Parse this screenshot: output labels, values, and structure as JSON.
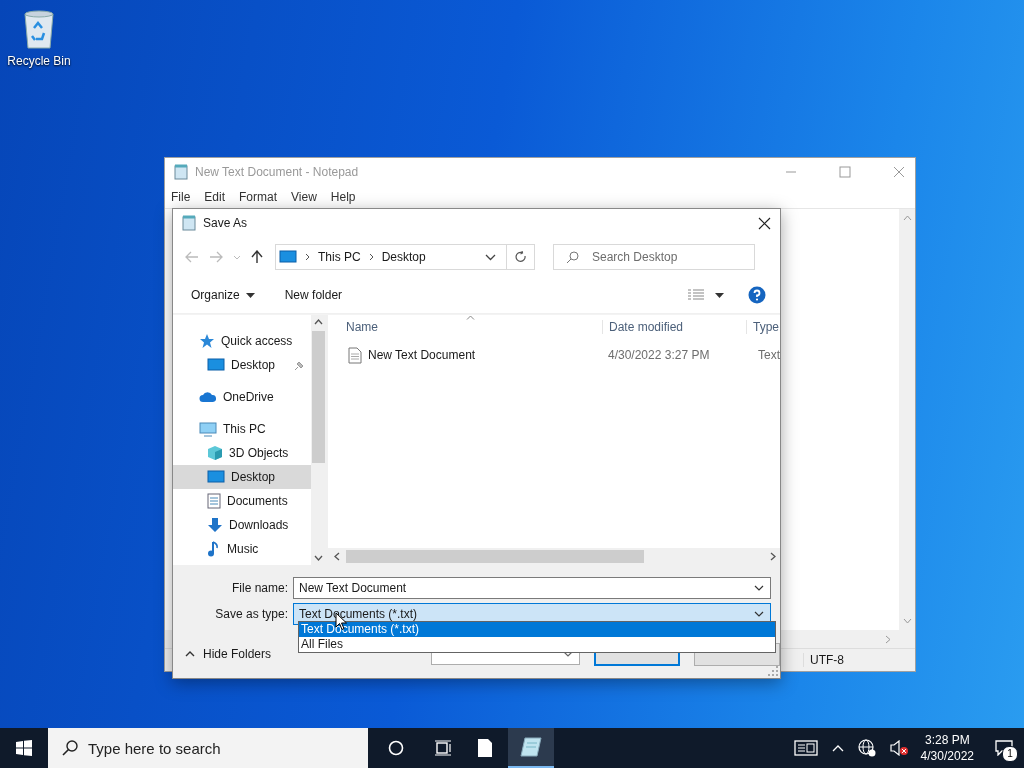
{
  "desktop": {
    "icons": [
      {
        "label": "Recycle Bin",
        "kind": "recycle"
      }
    ]
  },
  "notepad": {
    "title": "New Text Document - Notepad",
    "menu": [
      "File",
      "Edit",
      "Format",
      "View",
      "Help"
    ],
    "status_encoding": "UTF-8"
  },
  "save_dialog": {
    "title": "Save As",
    "breadcrumb": [
      "This PC",
      "Desktop"
    ],
    "search": {
      "placeholder": "Search Desktop"
    },
    "toolbar": [
      "Organize",
      "New folder"
    ],
    "nav": [
      {
        "label": "Quick access",
        "kind": "star",
        "selected": false,
        "children": [
          {
            "label": "Desktop",
            "kind": "desktop",
            "selected": false,
            "pinned": true
          }
        ]
      },
      {
        "label": "OneDrive",
        "kind": "cloud",
        "selected": false
      },
      {
        "label": "This PC",
        "kind": "pc",
        "selected": false,
        "children": [
          {
            "label": "3D Objects",
            "kind": "cube",
            "selected": false
          },
          {
            "label": "Desktop",
            "kind": "desktop",
            "selected": true
          },
          {
            "label": "Documents",
            "kind": "doc",
            "selected": false
          },
          {
            "label": "Downloads",
            "kind": "download",
            "selected": false
          },
          {
            "label": "Music",
            "kind": "music",
            "selected": false
          }
        ]
      }
    ],
    "columns": [
      "Name",
      "Date modified",
      "Type"
    ],
    "files": [
      {
        "name": "New Text Document",
        "date": "4/30/2022 3:27 PM",
        "type": "Text"
      }
    ],
    "file_name": {
      "label": "File name:",
      "value": "New Text Document"
    },
    "save_as_type": {
      "label": "Save as type:",
      "value": "Text Documents (*.txt)",
      "expanded": true,
      "options": [
        {
          "label": "Text Documents (*.txt)",
          "selected": true
        },
        {
          "label": "All Files",
          "selected": false
        }
      ]
    },
    "hide_folders": "Hide Folders",
    "buttons": [
      {
        "kind": "primary"
      },
      {
        "kind": "secondary"
      }
    ]
  },
  "taskbar": {
    "search": {
      "placeholder": "Type here to search"
    },
    "apps": [
      {
        "kind": "file",
        "active": false
      },
      {
        "kind": "notepad",
        "active": true
      }
    ],
    "time": "3:28 PM",
    "date": "4/30/2022",
    "notifications": "1"
  }
}
